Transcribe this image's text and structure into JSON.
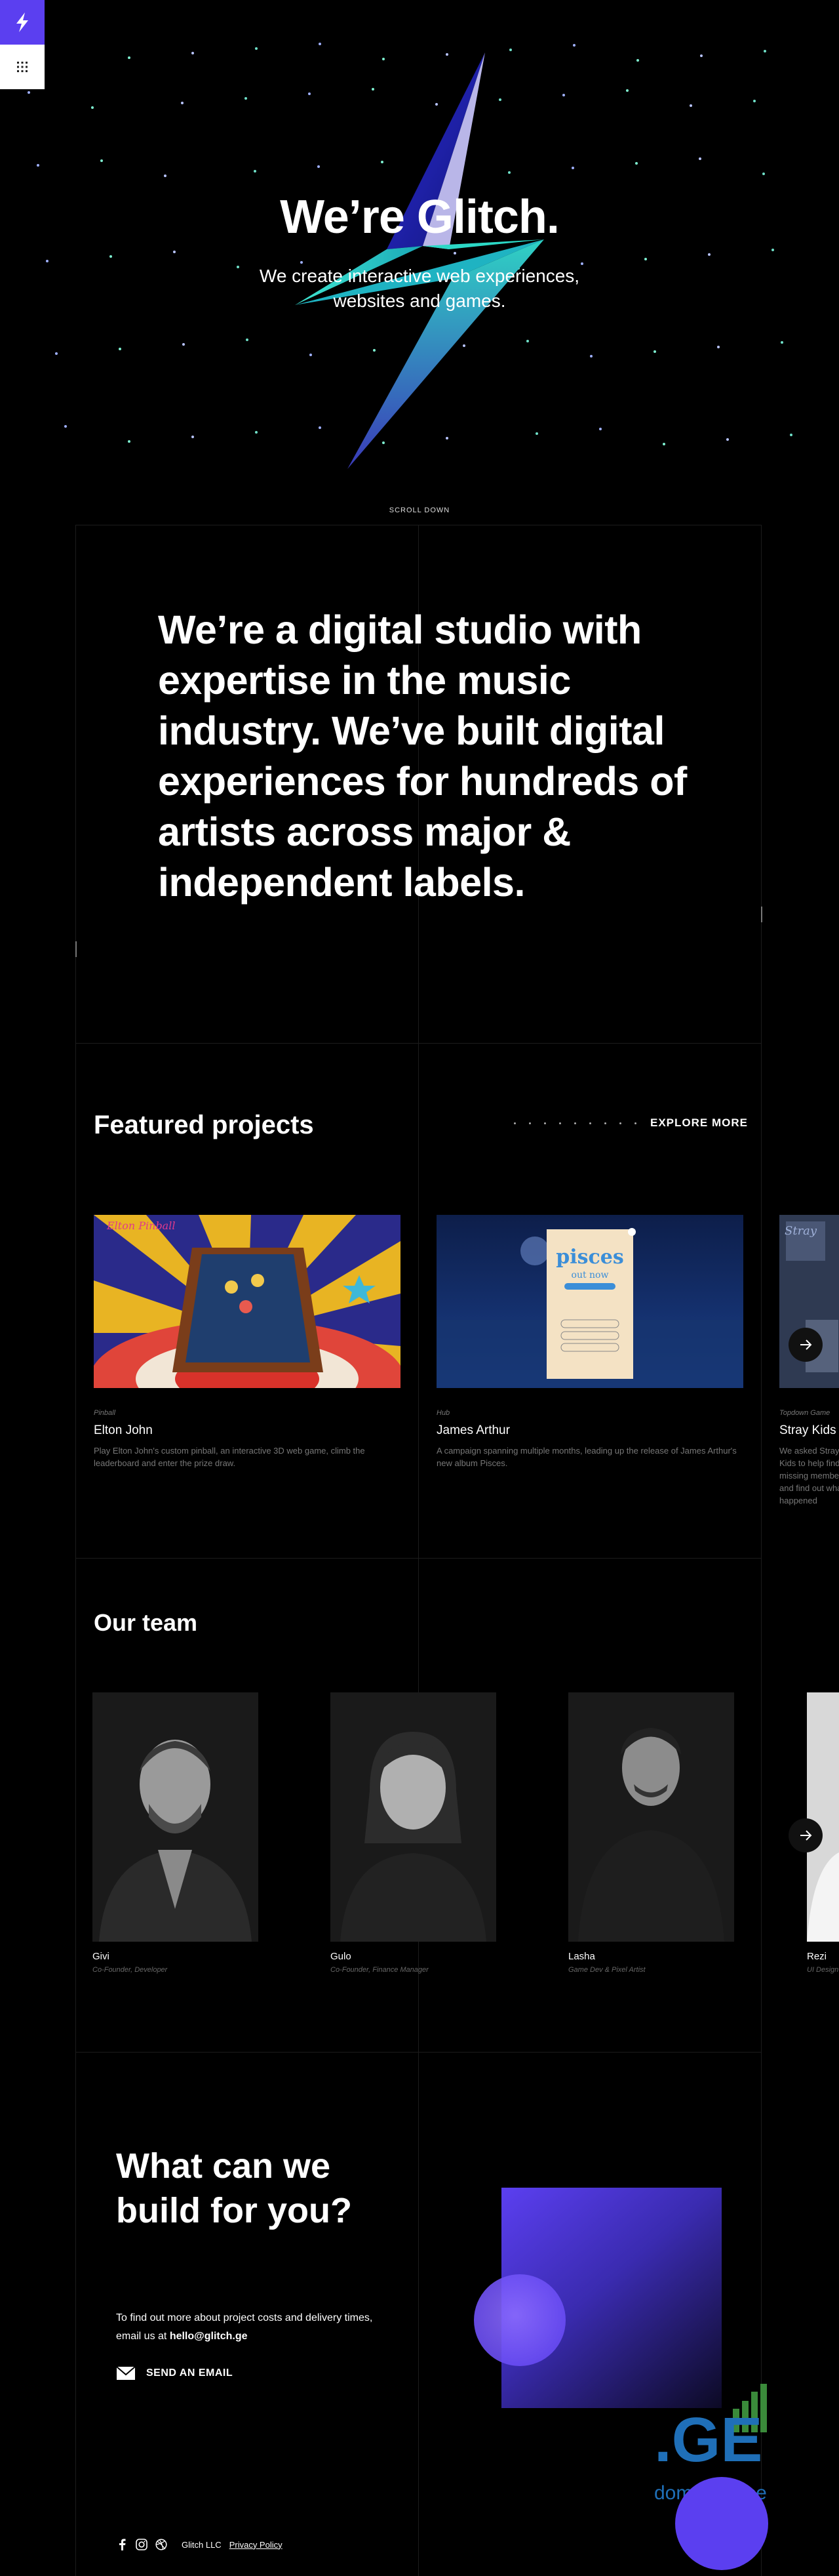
{
  "hero": {
    "title": "We’re Glitch.",
    "subtitle": "We create interactive web experiences, websites and games.",
    "scroll": "SCROLL DOWN"
  },
  "controls": {
    "logo_icon": "lightning-bolt-icon",
    "menu_icon": "grid-menu-icon"
  },
  "statement": "We’re a digital studio with expertise in the music industry. We’ve built digital experiences for hundreds of artists across major & independent labels.",
  "featured": {
    "title": "Featured projects",
    "explore": "EXPLORE MORE",
    "projects": [
      {
        "category": "Pinball",
        "name": "Elton John",
        "description": "Play Elton John's custom pinball, an interactive 3D web game, climb the leaderboard and enter the prize draw."
      },
      {
        "category": "Hub",
        "name": "James Arthur",
        "description": "A campaign spanning multiple months, leading up the release of James Arthur's new album Pisces."
      },
      {
        "category": "Topdown Game",
        "name": "Stray Kids",
        "description": "We asked Stray Kids to help find the missing members and find out what happened"
      }
    ],
    "pisces_text": "pisces",
    "pisces_sub": "out now"
  },
  "team": {
    "title": "Our team",
    "members": [
      {
        "name": "Givi",
        "role": "Co-Founder, Developer"
      },
      {
        "name": "Gulo",
        "role": "Co-Founder, Finance Manager"
      },
      {
        "name": "Lasha",
        "role": "Game Dev & Pixel Artist"
      },
      {
        "name": "Rezi",
        "role": "UI Design"
      }
    ]
  },
  "contact": {
    "title_line1": "What can we",
    "title_line2": "build for you?",
    "text_before": "To find out more about project costs and delivery times, email us at ",
    "email": "hello@glitch.ge",
    "send": "SEND AN EMAIL"
  },
  "footer": {
    "company": "Glitch LLC",
    "privacy": "Privacy Policy",
    "social_icons": [
      "facebook-icon",
      "instagram-icon",
      "dribbble-icon"
    ]
  },
  "watermark": {
    "logo": ".GE",
    "text": "domain base"
  },
  "colors": {
    "accent": "#5b3ff0",
    "background": "#000000",
    "muted": "#777777"
  }
}
